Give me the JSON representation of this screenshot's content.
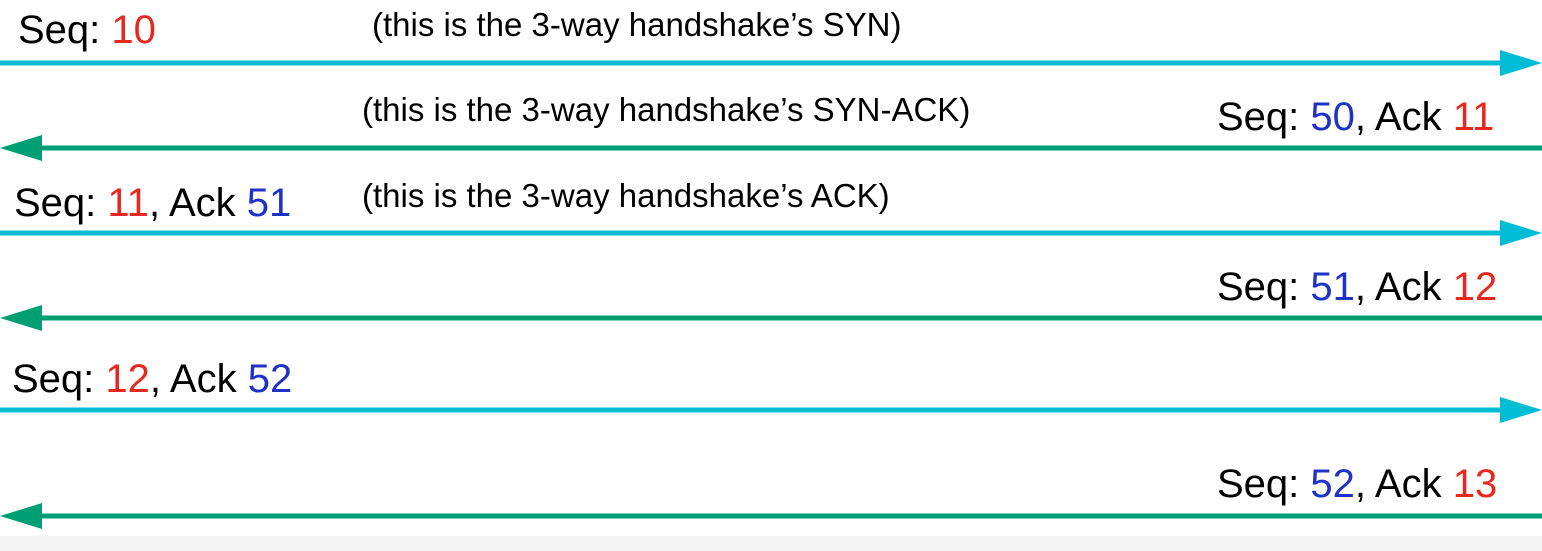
{
  "colors": {
    "client_arrow": "#00bcd4",
    "server_arrow": "#009e73",
    "client_seq": "#e8281e",
    "server_seq": "#1e32c8",
    "text": "#000000"
  },
  "messages": [
    {
      "direction": "right",
      "seq_label": "Seq: ",
      "seq": "10",
      "ack_label": "",
      "ack": "",
      "note": "(this is the 3-way handshake’s SYN)"
    },
    {
      "direction": "left",
      "seq_label": "Seq: ",
      "seq": "50",
      "ack_label": ", Ack ",
      "ack": "11",
      "note": "(this is the 3-way handshake’s SYN-ACK)"
    },
    {
      "direction": "right",
      "seq_label": "Seq: ",
      "seq": "11",
      "ack_label": ", Ack ",
      "ack": "51",
      "note": "(this is the 3-way handshake’s ACK)"
    },
    {
      "direction": "left",
      "seq_label": "Seq: ",
      "seq": "51",
      "ack_label": ", Ack ",
      "ack": "12",
      "note": ""
    },
    {
      "direction": "right",
      "seq_label": "Seq: ",
      "seq": "12",
      "ack_label": ", Ack ",
      "ack": "52",
      "note": ""
    },
    {
      "direction": "left",
      "seq_label": "Seq: ",
      "seq": "52",
      "ack_label": ", Ack ",
      "ack": "13",
      "note": ""
    }
  ]
}
